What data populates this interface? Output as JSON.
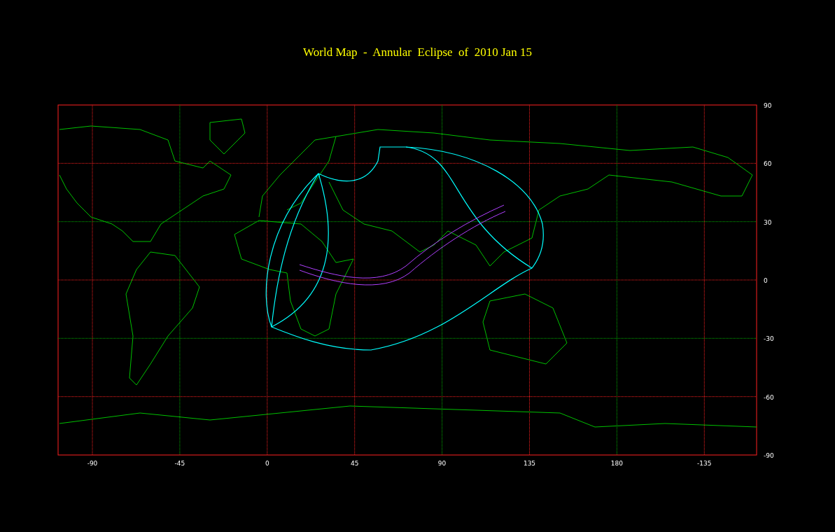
{
  "title": "World Map  -  Annular  Eclipse  of  2010 Jan 15",
  "x_labels": [
    "-90",
    "-45",
    "0",
    "45",
    "90",
    "135",
    "180",
    "-135"
  ],
  "y_labels": [
    "90",
    "60",
    "30",
    "0",
    "-30",
    "-60",
    "-90"
  ]
}
